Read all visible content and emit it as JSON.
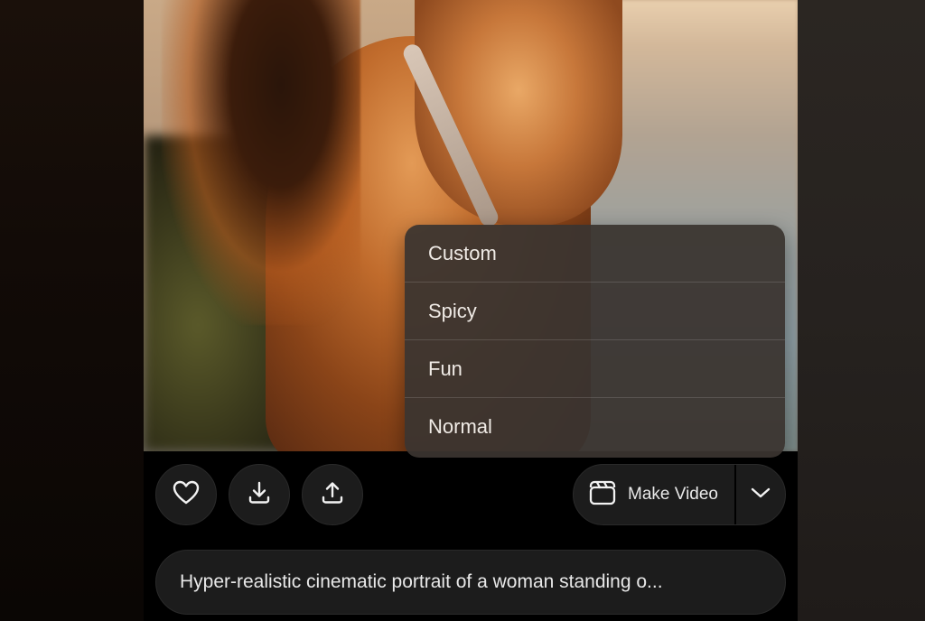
{
  "dropdown": {
    "items": [
      {
        "label": "Custom"
      },
      {
        "label": "Spicy"
      },
      {
        "label": "Fun"
      },
      {
        "label": "Normal"
      }
    ]
  },
  "actions": {
    "like_icon": "heart-icon",
    "download_icon": "download-icon",
    "share_icon": "share-icon",
    "make_video_label": "Make Video",
    "make_video_icon": "clapperboard-icon",
    "expand_icon": "chevron-down-icon"
  },
  "prompt": {
    "text": "Hyper-realistic cinematic portrait of a woman standing o..."
  }
}
